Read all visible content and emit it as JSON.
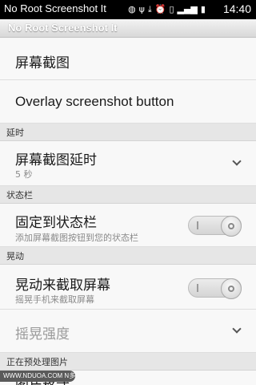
{
  "status_bar": {
    "app_title": "No Root Screenshot It",
    "icons": [
      "message-icon",
      "usb-icon",
      "download-icon",
      "alarm-icon",
      "vibrate-icon",
      "signal-icon",
      "battery-icon"
    ],
    "time": "14:40"
  },
  "action_bar": {
    "title": "No Root Screenshot It"
  },
  "items": {
    "screenshot": {
      "title": "屏幕截图"
    },
    "overlay": {
      "title": "Overlay screenshot button"
    },
    "delay": {
      "title": "屏幕截图延时",
      "value": "5 秒"
    },
    "pin": {
      "title": "固定到状态栏",
      "summary": "添加屏幕截图按钮到您的状态栏",
      "checked": false
    },
    "shake": {
      "title": "晃动来截取屏幕",
      "summary": "摇晃手机来截取屏幕",
      "checked": false
    },
    "shake_strength": {
      "title": "摇晃强度"
    },
    "format": {
      "title": "图片格式"
    }
  },
  "sections": {
    "delay": "延时",
    "status_bar": "状态栏",
    "shake": "晃动",
    "preprocess": "正在预处理图片"
  },
  "watermark": "WWW.NDUOA.COM N多网"
}
